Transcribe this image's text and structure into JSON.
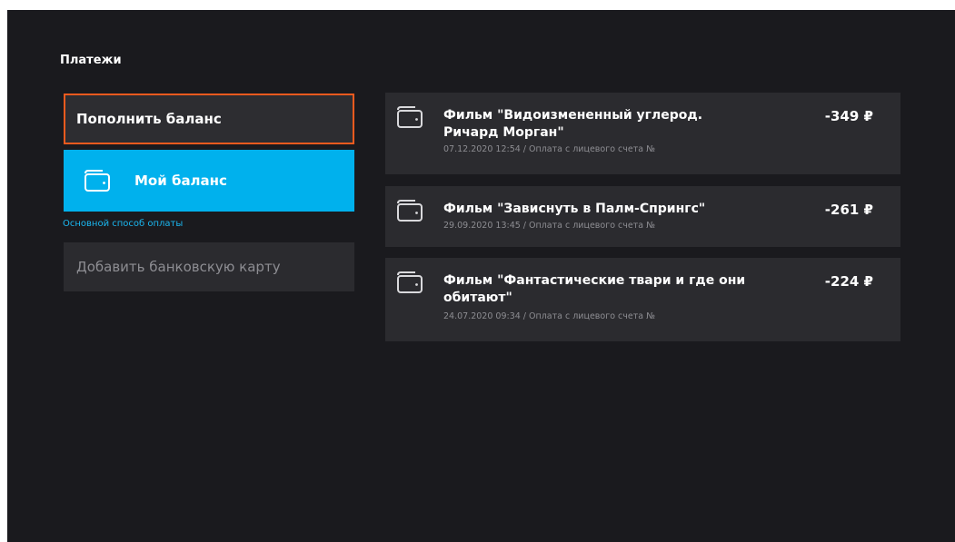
{
  "page": {
    "title": "Платежи"
  },
  "left": {
    "topup_label": "Пополнить баланс",
    "balance_label": "Мой баланс",
    "main_method_label": "Основной способ оплаты",
    "add_card_label": "Добавить банковскую карту"
  },
  "transactions": [
    {
      "title": "Фильм \"Видоизмененный углерод. Ричард Морган\"",
      "subtitle": "07.12.2020 12:54 / Оплата с лицевого счета №",
      "amount": "-349 ₽",
      "icon": "wallet-icon"
    },
    {
      "title": "Фильм \"Зависнуть в Палм-Спрингс\"",
      "subtitle": "29.09.2020 13:45 / Оплата с лицевого счета №",
      "amount": "-261 ₽",
      "icon": "wallet-icon"
    },
    {
      "title": "Фильм \"Фантастические твари и где они обитают\"",
      "subtitle": "24.07.2020 09:34 / Оплата с лицевого счета №",
      "amount": "-224 ₽",
      "icon": "wallet-icon"
    }
  ],
  "colors": {
    "background": "#1a1a1e",
    "card": "#2b2b2f",
    "focus_border": "#ee5a1e",
    "accent_blue": "#00b1ed",
    "accent_text_blue": "#1ab7f0",
    "muted_text": "#8d8d92"
  }
}
